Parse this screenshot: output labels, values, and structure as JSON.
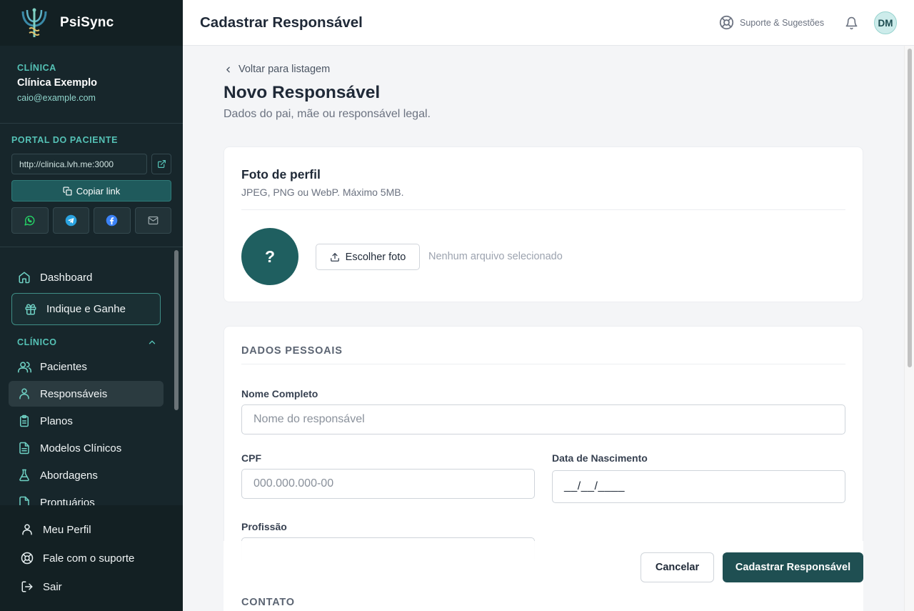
{
  "brand": {
    "name": "PsiSync"
  },
  "clinic": {
    "section_label": "CLÍNICA",
    "name": "Clínica Exemplo",
    "email": "caio@example.com"
  },
  "portal": {
    "section_label": "PORTAL DO PACIENTE",
    "url": "http://clinica.lvh.me:3000",
    "copy_label": "Copiar link",
    "share_icons": [
      "whatsapp-icon",
      "telegram-icon",
      "facebook-icon",
      "mail-icon"
    ]
  },
  "sidebar": {
    "dashboard": "Dashboard",
    "referral": "Indique e Ganhe",
    "group_clinical": "CLÍNICO",
    "items": [
      {
        "label": "Pacientes",
        "icon": "users-icon"
      },
      {
        "label": "Responsáveis",
        "icon": "user-icon",
        "active": true
      },
      {
        "label": "Planos",
        "icon": "clipboard-icon"
      },
      {
        "label": "Modelos Clínicos",
        "icon": "document-icon"
      },
      {
        "label": "Abordagens",
        "icon": "flask-icon"
      },
      {
        "label": "Prontuários",
        "icon": "file-icon"
      }
    ],
    "bottom": [
      {
        "label": "Meu Perfil",
        "icon": "user-icon"
      },
      {
        "label": "Fale com o suporte",
        "icon": "lifebuoy-icon"
      },
      {
        "label": "Sair",
        "icon": "logout-icon"
      }
    ]
  },
  "header": {
    "title": "Cadastrar Responsável",
    "support_label": "Suporte & Sugestões",
    "avatar_initials": "DM"
  },
  "page": {
    "back_label": "Voltar para listagem",
    "heading": "Novo Responsável",
    "subheading": "Dados do pai, mãe ou responsável legal."
  },
  "photo_card": {
    "title": "Foto de perfil",
    "description": "JPEG, PNG ou WebP. Máximo 5MB.",
    "placeholder_symbol": "?",
    "choose_label": "Escolher foto",
    "no_file": "Nenhum arquivo selecionado"
  },
  "personal": {
    "section_title": "DADOS PESSOAIS",
    "name_label": "Nome Completo",
    "name_placeholder": "Nome do responsável",
    "cpf_label": "CPF",
    "cpf_placeholder": "000.000.000-00",
    "birth_label": "Data de Nascimento",
    "birth_value": "__/__/____",
    "profession_label": "Profissão"
  },
  "actions": {
    "cancel": "Cancelar",
    "submit": "Cadastrar Responsável"
  },
  "next_section": "CONTATO",
  "colors": {
    "sidebar_bg": "#17262b",
    "accent": "#55c2b6",
    "primary_button": "#1f4f52"
  }
}
